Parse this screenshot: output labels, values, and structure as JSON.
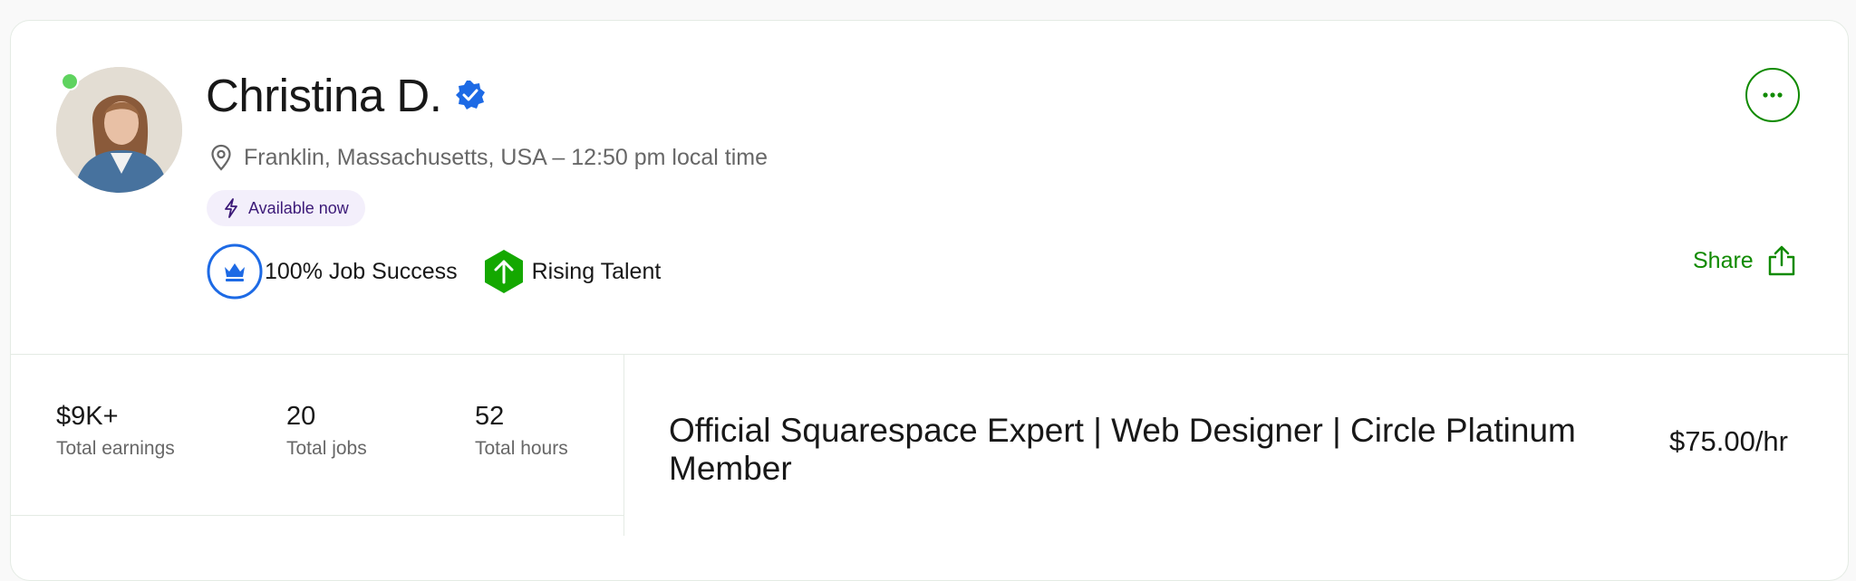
{
  "profile": {
    "name": "Christina D.",
    "location": "Franklin, Massachusetts, USA – 12:50 pm local time",
    "availability": "Available now",
    "job_success": "100% Job Success",
    "badge": "Rising Talent",
    "online": true
  },
  "actions": {
    "share_label": "Share",
    "more_icon": "ellipsis-icon"
  },
  "stats": {
    "earnings": {
      "value": "$9K+",
      "label": "Total earnings"
    },
    "jobs": {
      "value": "20",
      "label": "Total jobs"
    },
    "hours": {
      "value": "52",
      "label": "Total hours"
    }
  },
  "headline": {
    "title": "Official Squarespace Expert | Web Designer | Circle Platinum Member",
    "rate": "$75.00/hr"
  },
  "colors": {
    "brand_green": "#108a00",
    "verified_blue": "#1d6ae5",
    "online_green": "#5fd35f",
    "available_purple": "#3c1a78"
  }
}
